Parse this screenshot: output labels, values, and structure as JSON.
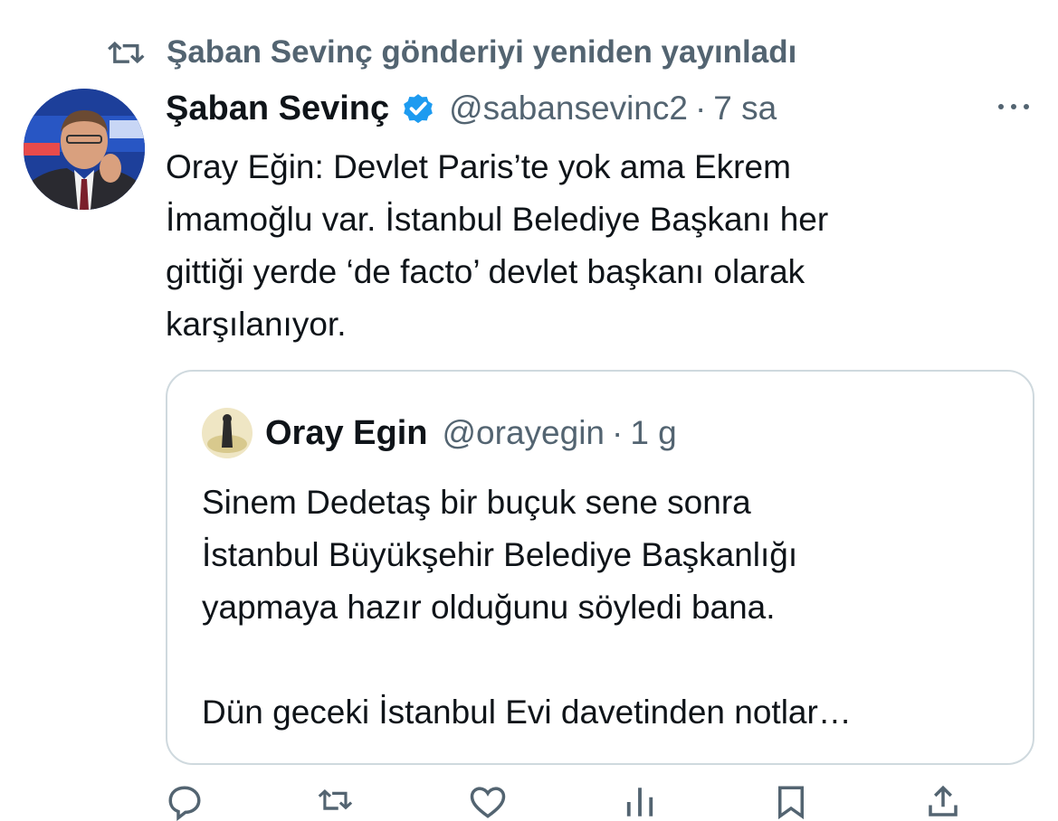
{
  "retweet_header": {
    "icon": "retweet-icon",
    "text": "Şaban Sevinç gönderiyi yeniden yayınladı"
  },
  "tweet": {
    "author_name": "Şaban Sevinç",
    "verified_icon": "verified-badge-icon",
    "handle": "@sabansevinc2",
    "separator": "·",
    "time": "7 sa",
    "more_icon": "more-options-icon",
    "text_lines": [
      "Oray Eğin: Devlet Paris’te yok ama Ekrem",
      "İmamoğlu var. İstanbul Belediye Başkanı her",
      "gittiği yerde ‘de facto’ devlet başkanı olarak",
      "karşılanıyor."
    ]
  },
  "quote": {
    "author_name": "Oray Egin",
    "handle": "@orayegin",
    "separator": "·",
    "time": "1 g",
    "text_lines": [
      "Sinem Dedetaş bir buçuk sene sonra",
      "İstanbul Büyükşehir Belediye Başkanlığı",
      "yapmaya hazır olduğunu söyledi bana.",
      "",
      "Dün geceki İstanbul Evi davetinden notlar…"
    ]
  },
  "actions": [
    {
      "icon": "reply-icon"
    },
    {
      "icon": "retweet-icon"
    },
    {
      "icon": "like-icon"
    },
    {
      "icon": "views-icon"
    },
    {
      "icon": "bookmark-icon"
    },
    {
      "icon": "share-icon"
    }
  ],
  "colors": {
    "text_primary": "#0f1419",
    "text_secondary": "#536471",
    "verified_blue": "#1d9bf0",
    "border": "#cfd9de"
  }
}
